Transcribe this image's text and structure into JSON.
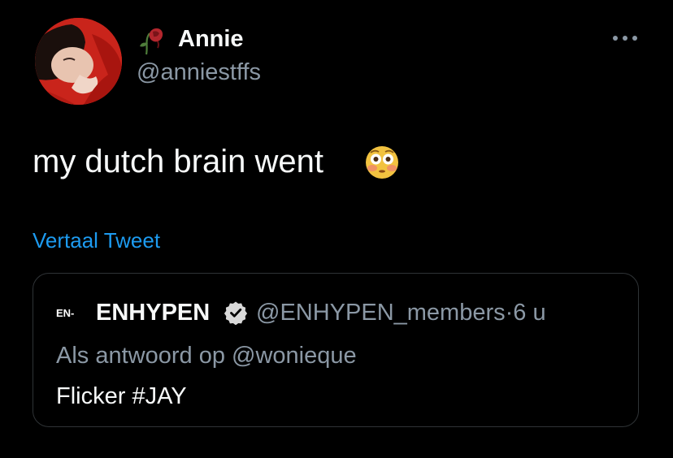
{
  "author": {
    "display_name": "Annie",
    "handle": "@anniestffs",
    "avatar_icon": "profile-photo",
    "name_emoji": "wilted-rose-icon"
  },
  "tweet": {
    "text": "my dutch brain went",
    "emoji": "flushed-face-icon",
    "translate_label": "Vertaal Tweet"
  },
  "quoted_tweet": {
    "logo_text": "EN-",
    "display_name": "ENHYPEN",
    "verified": true,
    "handle": "@ENHYPEN_members",
    "separator": "·",
    "time": "6 u",
    "reply_prefix": "Als antwoord op",
    "reply_to": "@wonieque",
    "text": "Flicker #JAY"
  },
  "colors": {
    "background": "#000000",
    "primary_text": "#f7f9f9",
    "secondary_text": "#8b98a5",
    "link": "#1d9bf0",
    "border": "#2f3336"
  }
}
